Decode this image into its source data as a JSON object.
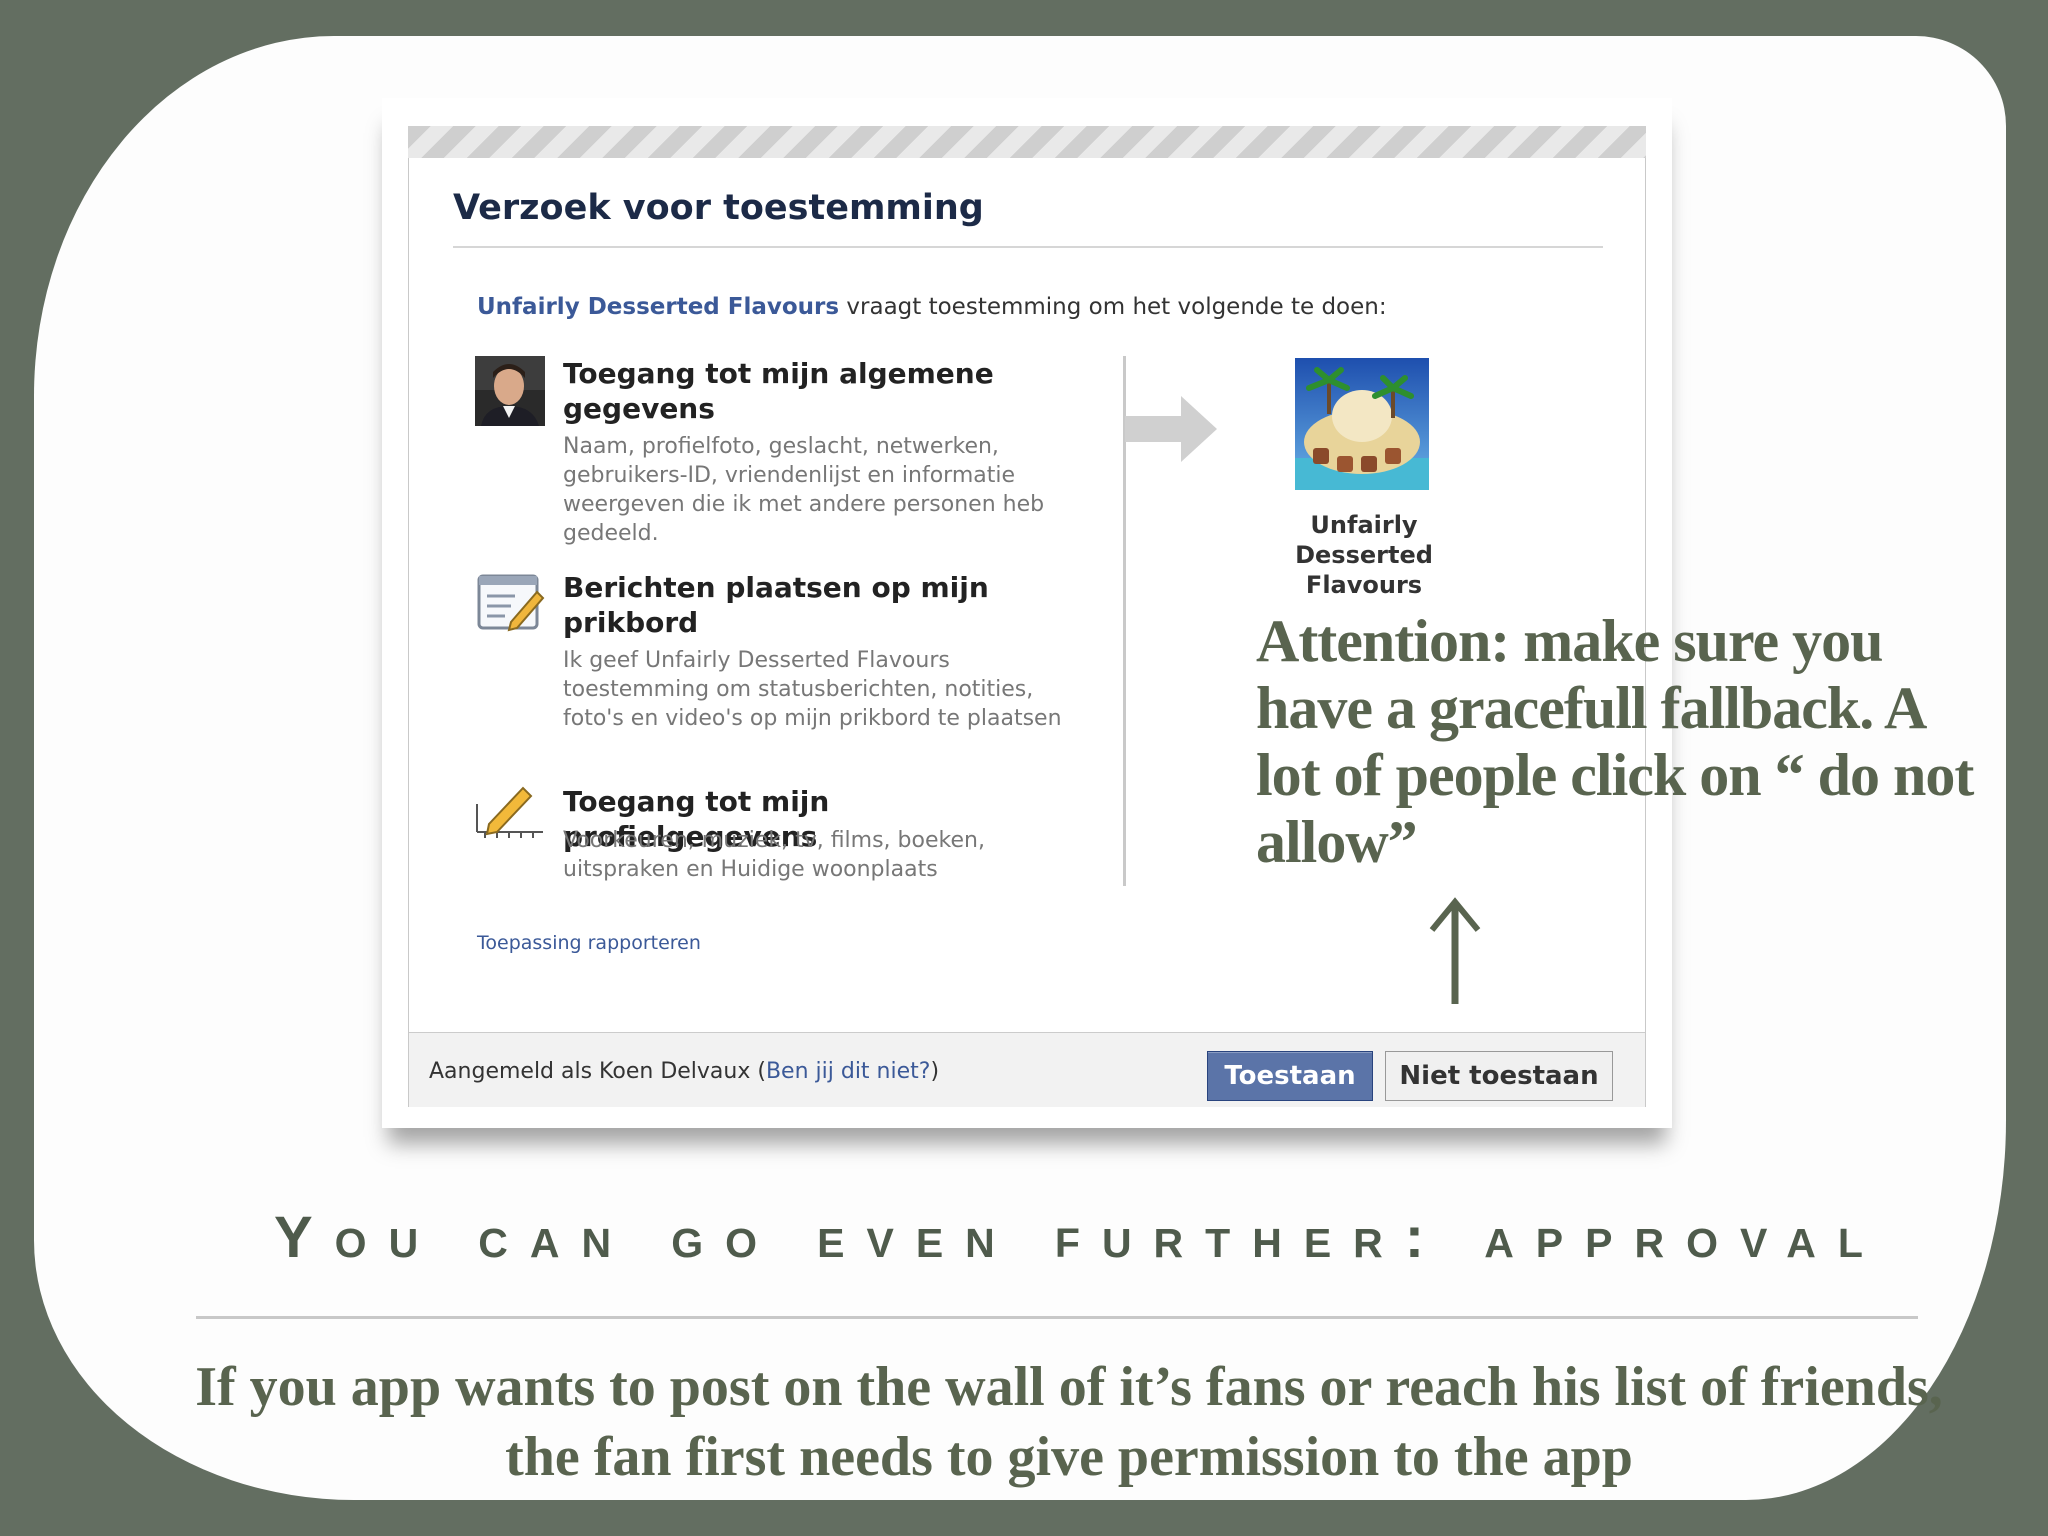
{
  "dialog": {
    "title": "Verzoek voor toestemming",
    "intro_app": "Unfairly Desserted Flavours",
    "intro_rest": " vraagt toestemming om het volgende te doen:",
    "permissions": [
      {
        "icon": "user-photo-icon",
        "title": "Toegang tot mijn algemene gegevens",
        "description": "Naam, profielfoto, geslacht, netwerken, gebruikers-ID, vriendenlijst en informatie weergeven die ik met andere personen heb gedeeld."
      },
      {
        "icon": "wall-post-icon",
        "title": "Berichten plaatsen op mijn prikbord",
        "description": "Ik geef Unfairly Desserted Flavours toestemming om statusberichten, notities, foto's en video's op mijn prikbord te plaatsen"
      },
      {
        "icon": "profile-edit-icon",
        "title": "Toegang tot mijn profielgegevens",
        "description": "Voorkeuren, muziek, tv, films, boeken, uitspraken en Huidige woonplaats"
      }
    ],
    "app_name": "Unfairly Desserted Flavours",
    "report_link": "Toepassing rapporteren",
    "logged_in_prefix": "Aangemeld als Koen Delvaux (",
    "not_you_link": "Ben jij dit niet?",
    "logged_in_suffix": ")",
    "allow_button": "Toestaan",
    "deny_button": "Niet toestaan"
  },
  "annotation": {
    "text": "Attention: make sure you have a gracefull fallback. A lot of people click on “ do not allow”"
  },
  "slide": {
    "heading": "You can go even further: approval",
    "body": "If you app wants to post on the wall of it’s fans or reach his list of friends, the fan first needs to give permission to the app"
  },
  "colors": {
    "background": "#636e61",
    "facebook_blue": "#3b5998",
    "slide_text": "#59644f"
  }
}
